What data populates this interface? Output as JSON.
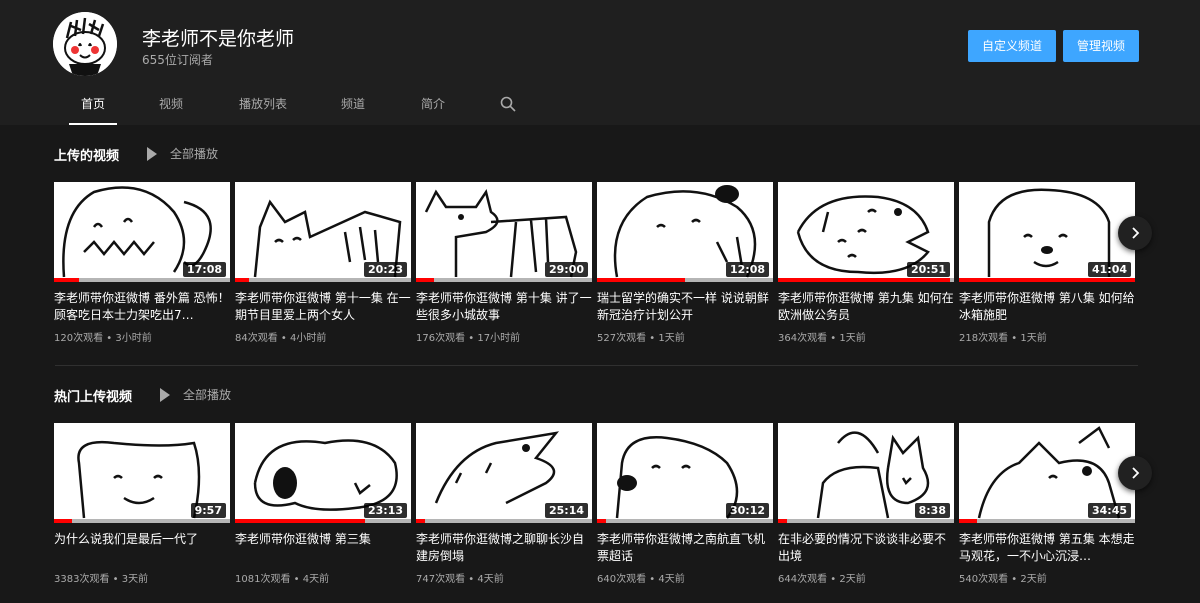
{
  "channel": {
    "name": "李老师不是你老师",
    "subscribers": "655位订阅者",
    "customize_label": "自定义频道",
    "manage_label": "管理视频"
  },
  "tabs": [
    {
      "label": "首页"
    },
    {
      "label": "视频"
    },
    {
      "label": "播放列表"
    },
    {
      "label": "频道"
    },
    {
      "label": "简介"
    }
  ],
  "icons": {
    "search": "search-icon",
    "play": "play-icon",
    "next": "chevron-right-icon"
  },
  "colors": {
    "accent": "#3ea6ff",
    "progress": "#ff0000",
    "background": "#181818",
    "header": "#1f1f1f"
  },
  "shelves": [
    {
      "title": "上传的视频",
      "play_all": "全部播放",
      "videos": [
        {
          "title": "李老师带你逛微博 番外篇 恐怖！顾客吃日本士力架吃出7…",
          "duration": "17:08",
          "views": "120次观看",
          "age": "3小时前",
          "progress": 0.14
        },
        {
          "title": "李老师带你逛微博 第十一集 在一期节目里爱上两个女人",
          "duration": "20:23",
          "views": "84次观看",
          "age": "4小时前",
          "progress": 0.08
        },
        {
          "title": "李老师带你逛微博 第十集 讲了一些很多小城故事",
          "duration": "29:00",
          "views": "176次观看",
          "age": "17小时前",
          "progress": 0.1
        },
        {
          "title": "瑞士留学的确实不一样 说说朝鲜新冠治疗计划公开",
          "duration": "12:08",
          "views": "527次观看",
          "age": "1天前",
          "progress": 0.5
        },
        {
          "title": "李老师带你逛微博 第九集 如何在欧洲做公务员",
          "duration": "20:51",
          "views": "364次观看",
          "age": "1天前",
          "progress": 0.98
        },
        {
          "title": "李老师带你逛微博 第八集 如何给冰箱施肥",
          "duration": "41:04",
          "views": "218次观看",
          "age": "1天前",
          "progress": 1.0
        }
      ]
    },
    {
      "title": "热门上传视频",
      "play_all": "全部播放",
      "videos": [
        {
          "title": "为什么说我们是最后一代了",
          "duration": "9:57",
          "views": "3383次观看",
          "age": "3天前",
          "progress": 0.1
        },
        {
          "title": "李老师带你逛微博 第三集",
          "duration": "23:13",
          "views": "1081次观看",
          "age": "4天前",
          "progress": 0.74
        },
        {
          "title": "李老师带你逛微博之聊聊长沙自建房倒塌",
          "duration": "25:14",
          "views": "747次观看",
          "age": "4天前",
          "progress": 0.05
        },
        {
          "title": "李老师带你逛微博之南航直飞机票超话",
          "duration": "30:12",
          "views": "640次观看",
          "age": "4天前",
          "progress": 0.05
        },
        {
          "title": "在非必要的情况下谈谈非必要不出境",
          "duration": "8:38",
          "views": "644次观看",
          "age": "2天前",
          "progress": 0.05
        },
        {
          "title": "李老师带你逛微博 第五集 本想走马观花，一不小心沉浸…",
          "duration": "34:45",
          "views": "540次观看",
          "age": "2天前",
          "progress": 0.1
        }
      ]
    }
  ]
}
